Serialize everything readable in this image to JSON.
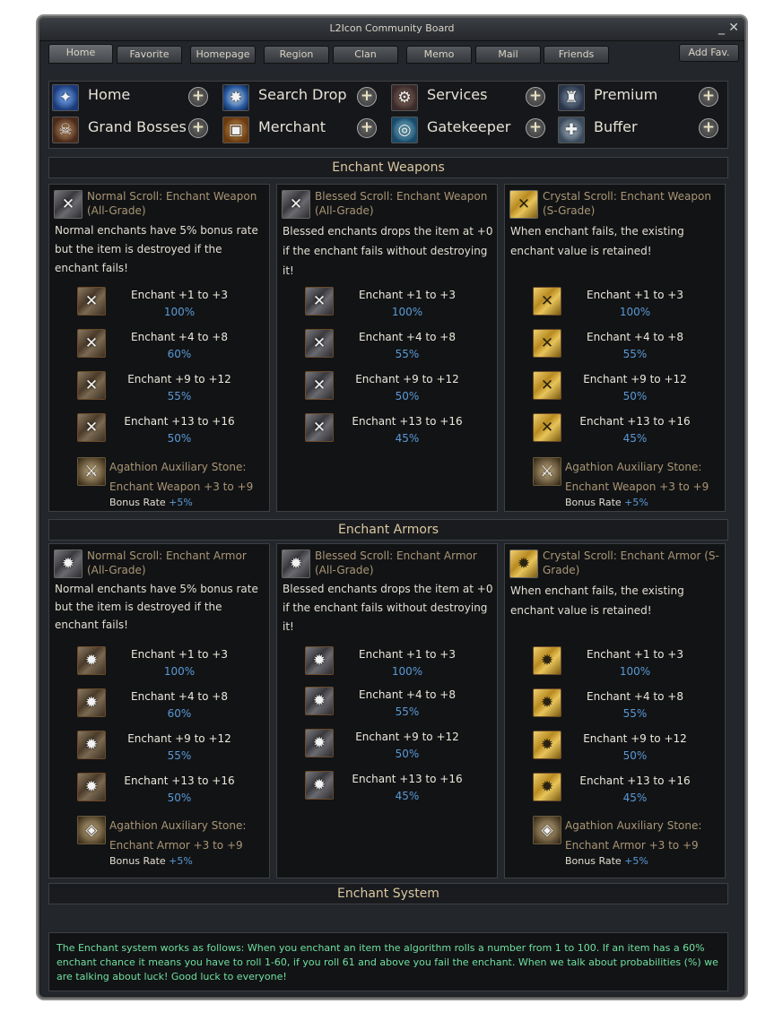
{
  "window": {
    "title": "L2Icon Community Board",
    "minimize": "_",
    "close": "✕"
  },
  "tabs": [
    {
      "label": "Home",
      "active": true
    },
    {
      "label": "Favorite"
    },
    {
      "label": "Homepage"
    },
    {
      "label": "Region"
    },
    {
      "label": "Clan"
    },
    {
      "label": "Memo"
    },
    {
      "label": "Mail"
    },
    {
      "label": "Friends"
    }
  ],
  "add_fav_label": "Add Fav.",
  "nav": {
    "items": [
      {
        "label": "Home",
        "icon": "home-icon"
      },
      {
        "label": "Search Drop",
        "icon": "search-drop-icon"
      },
      {
        "label": "Services",
        "icon": "services-gear-icon"
      },
      {
        "label": "Premium",
        "icon": "premium-icon"
      },
      {
        "label": "Grand Bosses",
        "icon": "grand-bosses-icon"
      },
      {
        "label": "Merchant",
        "icon": "merchant-chest-icon"
      },
      {
        "label": "Gatekeeper",
        "icon": "gatekeeper-swirl-icon"
      },
      {
        "label": "Buffer",
        "icon": "buffer-icon"
      }
    ],
    "plus_symbol": "+"
  },
  "sections": {
    "weapons": {
      "title": "Enchant Weapons",
      "cards": [
        {
          "title": "Normal Scroll: Enchant Weapon (All-Grade)",
          "desc": "Normal enchants have 5% bonus rate but the item is destroyed if the enchant fails!",
          "rows": [
            {
              "label": "Enchant +1 to +3",
              "pct": "100%"
            },
            {
              "label": "Enchant +4 to +8",
              "pct": "60%"
            },
            {
              "label": "Enchant +9 to +12",
              "pct": "55%"
            },
            {
              "label": "Enchant +13 to +16",
              "pct": "50%"
            }
          ],
          "stone": {
            "text": "Agathion Auxiliary Stone: Enchant Weapon +3 to +9",
            "bonus_label": "Bonus Rate",
            "bonus_value": "+5%"
          }
        },
        {
          "title": "Blessed Scroll: Enchant Weapon (All-Grade)",
          "desc": "Blessed enchants drops the item at +0 if the enchant fails without destroying it!",
          "rows": [
            {
              "label": "Enchant +1 to +3",
              "pct": "100%"
            },
            {
              "label": "Enchant +4 to +8",
              "pct": "55%"
            },
            {
              "label": "Enchant +9 to +12",
              "pct": "50%"
            },
            {
              "label": "Enchant +13 to +16",
              "pct": "45%"
            }
          ]
        },
        {
          "title": "Crystal Scroll: Enchant Weapon (S-Grade)",
          "desc": "When enchant fails, the existing enchant value is retained!",
          "rows": [
            {
              "label": "Enchant +1 to +3",
              "pct": "100%"
            },
            {
              "label": "Enchant +4 to +8",
              "pct": "55%"
            },
            {
              "label": "Enchant +9 to +12",
              "pct": "50%"
            },
            {
              "label": "Enchant +13 to +16",
              "pct": "45%"
            }
          ],
          "stone": {
            "text": "Agathion Auxiliary Stone: Enchant Weapon +3 to +9",
            "bonus_label": "Bonus Rate",
            "bonus_value": "+5%"
          }
        }
      ]
    },
    "armors": {
      "title": "Enchant Armors",
      "cards": [
        {
          "title": "Normal Scroll: Enchant Armor (All-Grade)",
          "desc": "Normal enchants have 5% bonus rate but the item is destroyed if the enchant fails!",
          "rows": [
            {
              "label": "Enchant +1 to +3",
              "pct": "100%"
            },
            {
              "label": "Enchant +4 to +8",
              "pct": "60%"
            },
            {
              "label": "Enchant +9 to +12",
              "pct": "55%"
            },
            {
              "label": "Enchant +13 to +16",
              "pct": "50%"
            }
          ],
          "stone": {
            "text": "Agathion Auxiliary Stone: Enchant Armor +3 to +9",
            "bonus_label": "Bonus Rate",
            "bonus_value": "+5%"
          }
        },
        {
          "title": "Blessed Scroll: Enchant Armor (All-Grade)",
          "desc": "Blessed enchants drops the item at +0 if the enchant fails without destroying it!",
          "rows": [
            {
              "label": "Enchant +1 to +3",
              "pct": "100%"
            },
            {
              "label": "Enchant +4 to +8",
              "pct": "55%"
            },
            {
              "label": "Enchant +9 to +12",
              "pct": "50%"
            },
            {
              "label": "Enchant +13 to +16",
              "pct": "45%"
            }
          ]
        },
        {
          "title": "Crystal Scroll: Enchant Armor (S-Grade)",
          "desc": "When enchant fails, the existing enchant value is retained!",
          "rows": [
            {
              "label": "Enchant +1 to +3",
              "pct": "100%"
            },
            {
              "label": "Enchant +4 to +8",
              "pct": "55%"
            },
            {
              "label": "Enchant +9 to +12",
              "pct": "50%"
            },
            {
              "label": "Enchant +13 to +16",
              "pct": "45%"
            }
          ],
          "stone": {
            "text": "Agathion Auxiliary Stone: Enchant Armor +3 to +9",
            "bonus_label": "Bonus Rate",
            "bonus_value": "+5%"
          }
        }
      ]
    },
    "system": {
      "title": "Enchant System",
      "text": "The Enchant system works as follows: When you enchant an item the algorithm rolls a number from 1 to 100. If an item has a 60% enchant chance it means you have to roll 1-60, if you roll 61 and above you fail the enchant. When we talk about probabilities (%) we are talking about luck! Good luck to everyone!"
    }
  },
  "colors": {
    "accent_title": "#d9c8a2",
    "percent": "#5a9ad6",
    "system_text": "#6fe0a0"
  }
}
